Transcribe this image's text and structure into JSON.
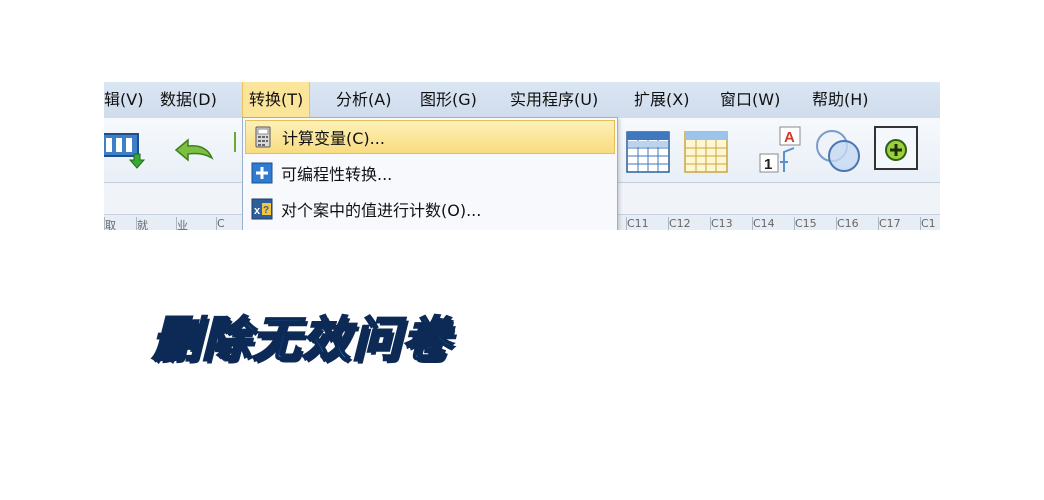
{
  "menubar": {
    "items": [
      {
        "label": "辑(V)"
      },
      {
        "label": "数据(D)"
      },
      {
        "label": "转换(T)"
      },
      {
        "label": "分析(A)"
      },
      {
        "label": "图形(G)"
      },
      {
        "label": "实用程序(U)"
      },
      {
        "label": "扩展(X)"
      },
      {
        "label": "窗口(W)"
      },
      {
        "label": "帮助(H)"
      }
    ],
    "active_index": 2,
    "active_color": "#fbe59b"
  },
  "dropdown": {
    "items": [
      {
        "label": "计算变量(C)...",
        "icon": "calculator-icon"
      },
      {
        "label": "可编程性转换...",
        "icon": "plus-box-icon"
      },
      {
        "label": "对个案中的值进行计数(O)...",
        "icon": "count-values-icon"
      }
    ],
    "highlighted_index": 0
  },
  "toolbar": {
    "icons": [
      "recall-dialog-icon",
      "undo-icon",
      "variables-table-icon",
      "grid-table-icon",
      "value-labels-icon",
      "venn-circles-icon",
      "add-circle-icon"
    ]
  },
  "colheads": {
    "labels": [
      "取",
      "就",
      "业",
      "C",
      "C11",
      "C12",
      "C13",
      "C14",
      "C15",
      "C16",
      "C17",
      "C1"
    ]
  },
  "caption": {
    "text": "删除无效问卷",
    "color": "#1a7fd0",
    "outline_color": "#0c2a55"
  }
}
